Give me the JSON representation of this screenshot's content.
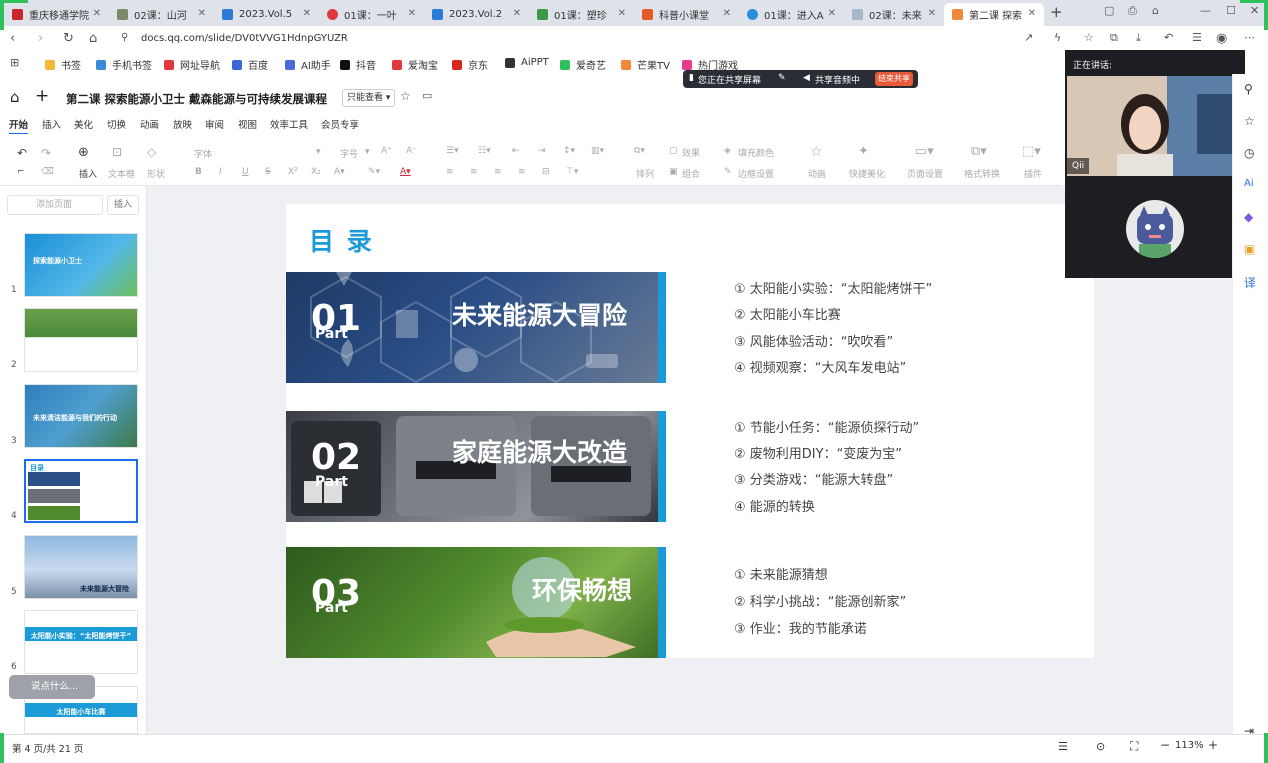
{
  "browser": {
    "tabs": [
      {
        "label": "重庆移通学院",
        "icon": "university-icon",
        "color": "#c8262c"
      },
      {
        "label": "02课：山河",
        "icon": "mountain-icon",
        "color": "#7a8a6a"
      },
      {
        "label": "2023.Vol.5",
        "icon": "play-icon",
        "color": "#2b7bd6"
      },
      {
        "label": "01课：一叶",
        "icon": "pin-icon",
        "color": "#e0383a"
      },
      {
        "label": "2023.Vol.2",
        "icon": "play-icon",
        "color": "#2b7bd6"
      },
      {
        "label": "01课：塑珍",
        "icon": "tree-icon",
        "color": "#3a9a4a"
      },
      {
        "label": "科普小课堂",
        "icon": "shield-icon",
        "color": "#e25a2a"
      },
      {
        "label": "01课：进入A",
        "icon": "globe-icon",
        "color": "#2a8fd9"
      },
      {
        "label": "02课：未来",
        "icon": "cloud-icon",
        "color": "#a7b8c8"
      },
      {
        "label": "第二课 探索",
        "icon": "slides-icon",
        "color": "#f08a3a"
      }
    ],
    "new_tab": "+",
    "url": "docs.qq.com/slide/DV0tVVG1HdnpGYUZR",
    "bookmarks": [
      {
        "label": "书签",
        "color": "#f3b83a"
      },
      {
        "label": "手机书签",
        "color": "#3a8ad9"
      },
      {
        "label": "网址导航",
        "color": "#e0383a"
      },
      {
        "label": "百度",
        "color": "#3a66d9"
      },
      {
        "label": "AI助手",
        "color": "#4a6ad9"
      },
      {
        "label": "抖音",
        "color": "#111111"
      },
      {
        "label": "爱淘宝",
        "color": "#e0383a"
      },
      {
        "label": "京东",
        "color": "#d9261c"
      },
      {
        "label": "AiPPT",
        "color": "#333333"
      },
      {
        "label": "爱奇艺",
        "color": "#2fc15c"
      },
      {
        "label": "芒果TV",
        "color": "#f08a3a"
      },
      {
        "label": "热门游戏",
        "color": "#e83a8a"
      }
    ]
  },
  "share_banner": {
    "sharing_text": "您正在共享屏幕",
    "audio_text": "共享音频中",
    "stop_label": "结束共享"
  },
  "doc": {
    "title": "第二课 探索能源小卫士 戴森能源与可持续发展课程",
    "mode": "只能查看",
    "menu": [
      "开始",
      "插入",
      "美化",
      "切换",
      "动画",
      "放映",
      "审阅",
      "视图",
      "效率工具",
      "会员专享"
    ],
    "toolbar": {
      "insert": "插入",
      "textbox": "文本框",
      "shape": "形状",
      "font": "字体",
      "font_size": "字号",
      "arrange": "排列",
      "combine": "组合",
      "effect": "效果",
      "fill": "填充颜色",
      "border": "边框设置",
      "animation": "动画",
      "quick_beautify": "快捷美化",
      "page_setup": "页面设置",
      "format_convert": "格式转换",
      "plugins": "插件"
    },
    "add_page_placeholder": "添加页面",
    "insert_label": "插入",
    "comment_placeholder": "说点什么...",
    "status": {
      "page_info": "第 4 页/共 21 页",
      "zoom": "113%"
    }
  },
  "thumbnails": [
    {
      "num": "1",
      "title": "探索能源小卫士"
    },
    {
      "num": "2",
      "title": ""
    },
    {
      "num": "3",
      "title": "未来清洁能源与我们的行动"
    },
    {
      "num": "4",
      "title": "目录"
    },
    {
      "num": "5",
      "title": "未来能源大冒险"
    },
    {
      "num": "6",
      "title": "太阳能小实验：“太阳能烤饼干”"
    },
    {
      "num": "7",
      "title": "太阳能小车比赛"
    }
  ],
  "slide": {
    "title": "目 录",
    "sections": [
      {
        "num": "01",
        "part": "Part",
        "heading": "未来能源大冒险",
        "items": [
          "① 太阳能小实验：“太阳能烤饼干”",
          "② 太阳能小车比赛",
          "③ 风能体验活动：“吹吹看”",
          "④ 视频观察：“大风车发电站”"
        ]
      },
      {
        "num": "02",
        "part": "Part",
        "heading": "家庭能源大改造",
        "items": [
          "① 节能小任务：“能源侦探行动”",
          "② 废物利用DIY：“变废为宝”",
          "③ 分类游戏：“能源大转盘”",
          "④ 能源的转换"
        ]
      },
      {
        "num": "03",
        "part": "Part",
        "heading": "环保畅想",
        "items": [
          "① 未来能源猜想",
          "② 科学小挑战：“能源创新家”",
          "③ 作业：我的节能承诺"
        ]
      }
    ]
  },
  "video": {
    "speaking_label": "正在讲话:",
    "participant": "Qii"
  }
}
